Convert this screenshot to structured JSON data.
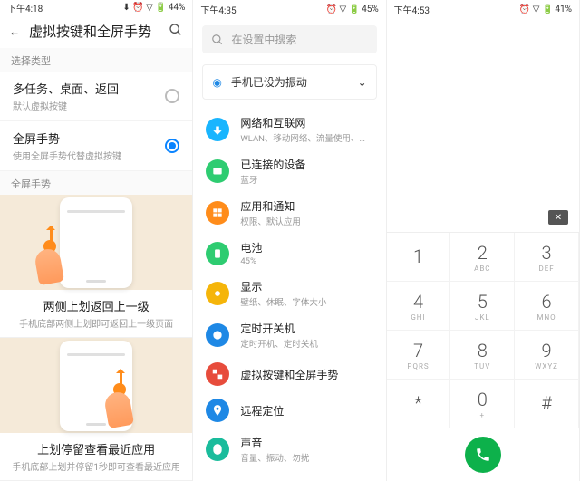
{
  "p1": {
    "status": {
      "time": "下午4:18",
      "battery": "44%"
    },
    "title": "虚拟按键和全屏手势",
    "section_label": "选择类型",
    "opt1": {
      "t": "多任务、桌面、返回",
      "s": "默认虚拟按键"
    },
    "opt2": {
      "t": "全屏手势",
      "s": "使用全屏手势代替虚拟按键"
    },
    "section2_label": "全屏手势",
    "g1": {
      "t": "两侧上划返回上一级",
      "s": "手机底部两侧上划即可返回上一级页面"
    },
    "g2": {
      "t": "上划停留查看最近应用",
      "s": "手机底部上划并停留1秒即可查看最近应用"
    }
  },
  "p2": {
    "status": {
      "time": "下午4:35",
      "battery": "45%"
    },
    "search_ph": "在设置中搜索",
    "banner": "手机已设为振动",
    "items": [
      {
        "t": "网络和互联网",
        "s": "WLAN、移动网络、流量使用、热点",
        "c": "#19b5fe"
      },
      {
        "t": "已连接的设备",
        "s": "蓝牙",
        "c": "#2ecc71"
      },
      {
        "t": "应用和通知",
        "s": "权限、默认应用",
        "c": "#ff8c1a"
      },
      {
        "t": "电池",
        "s": "45%",
        "c": "#2ecc71"
      },
      {
        "t": "显示",
        "s": "壁纸、休眠、字体大小",
        "c": "#f5b50a"
      },
      {
        "t": "定时开关机",
        "s": "定时开机、定时关机",
        "c": "#1e88e5"
      },
      {
        "t": "虚拟按键和全屏手势",
        "s": "",
        "c": "#e74c3c"
      },
      {
        "t": "远程定位",
        "s": "",
        "c": "#1e88e5"
      },
      {
        "t": "声音",
        "s": "音量、振动、勿扰",
        "c": "#1abc9c"
      }
    ]
  },
  "p3": {
    "status": {
      "time": "下午4:53",
      "battery": "41%"
    },
    "keys": [
      {
        "d": "1",
        "l": ""
      },
      {
        "d": "2",
        "l": "ABC"
      },
      {
        "d": "3",
        "l": "DEF"
      },
      {
        "d": "4",
        "l": "GHI"
      },
      {
        "d": "5",
        "l": "JKL"
      },
      {
        "d": "6",
        "l": "MNO"
      },
      {
        "d": "7",
        "l": "PQRS"
      },
      {
        "d": "8",
        "l": "TUV"
      },
      {
        "d": "9",
        "l": "WXYZ"
      },
      {
        "d": "*",
        "l": ""
      },
      {
        "d": "0",
        "l": "+"
      },
      {
        "d": "#",
        "l": ""
      }
    ]
  }
}
